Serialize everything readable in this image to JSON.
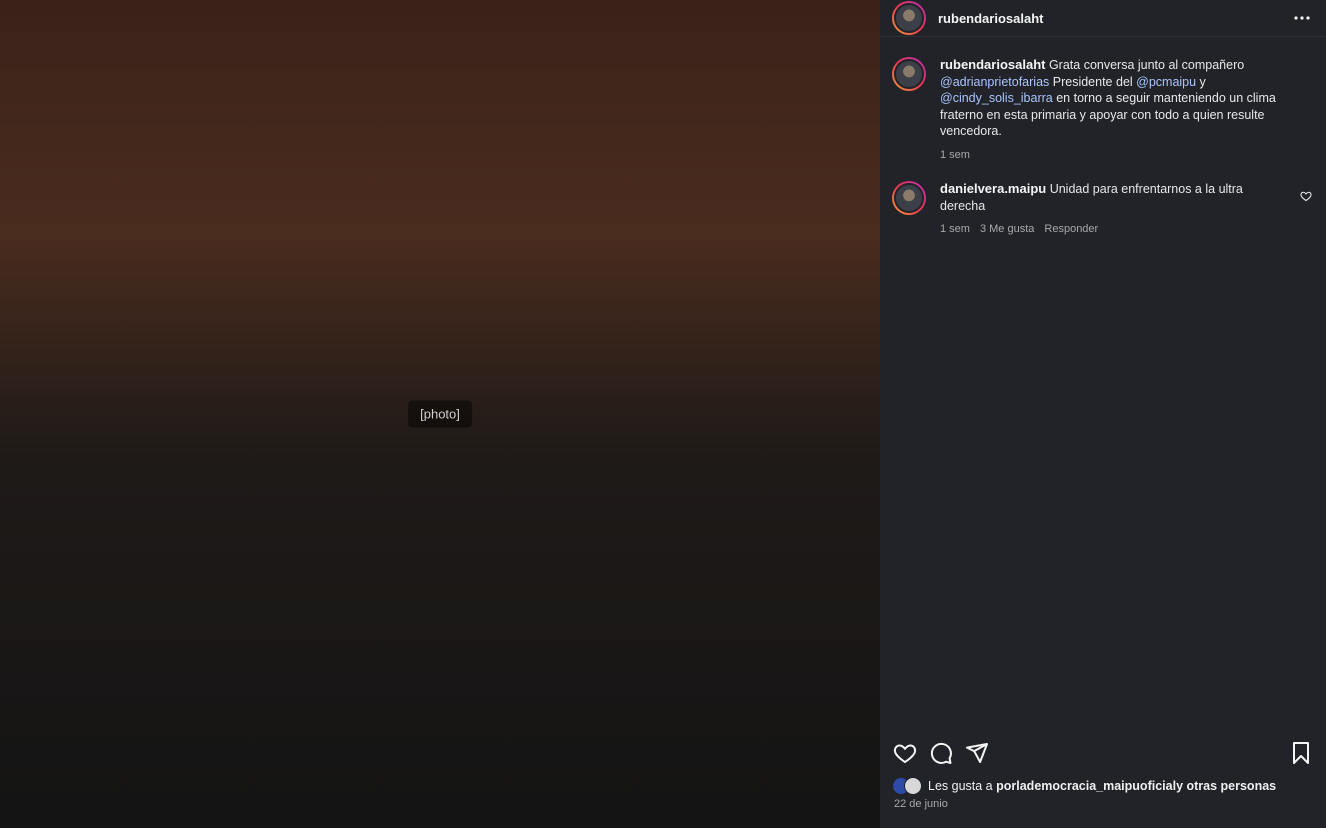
{
  "photo": {
    "caption": "[photo]"
  },
  "post": {
    "author": "rubendariosalaht",
    "more_icon": "more-horizontal-icon"
  },
  "comments": [
    {
      "username": "rubendariosalaht",
      "text_parts": [
        {
          "type": "text",
          "value": "Grata conversa junto al compañero "
        },
        {
          "type": "mention",
          "value": "@adrianprietofarias"
        },
        {
          "type": "text",
          "value": " Presidente del "
        },
        {
          "type": "mention",
          "value": "@pcmaipu"
        },
        {
          "type": "text",
          "value": " y "
        },
        {
          "type": "mention",
          "value": "@cindy_solis_ibarra"
        },
        {
          "type": "text",
          "value": " en torno a seguir manteniendo un clima fraterno en esta primaria y apoyar con todo a quien resulte vencedora."
        }
      ],
      "time": "1 sem"
    },
    {
      "username": "danielvera.maipu",
      "text": "Unidad para enfrentarnos a la ultra derecha",
      "time": "1 sem",
      "likes": "3 Me gusta",
      "reply": "Responder"
    }
  ],
  "actions": {
    "like_icon": "heart-icon",
    "comment_icon": "comment-icon",
    "share_icon": "send-icon",
    "save_icon": "bookmark-icon"
  },
  "likes": {
    "prefix": "Les gusta a ",
    "user": "porlademocracia_maipuoficial",
    "suffix": " y otras personas"
  },
  "date": "22 de junio",
  "colors": {
    "panel_bg": "#212328",
    "mention": "#a9c4ff",
    "muted": "#a8a8a8"
  }
}
